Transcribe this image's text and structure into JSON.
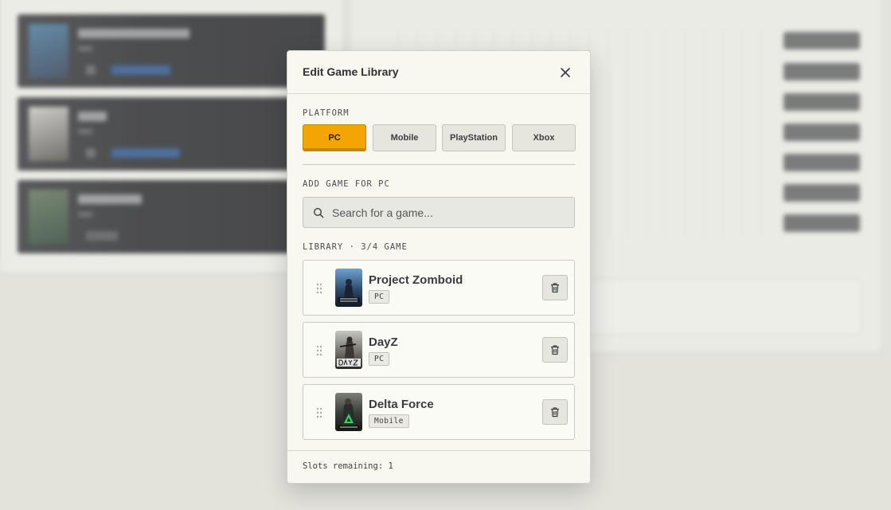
{
  "background": {
    "cards": [
      {
        "title": "Project Zomboid"
      },
      {
        "title": "DayZ"
      },
      {
        "title": "Delta Force"
      }
    ]
  },
  "modal": {
    "title": "Edit Game Library",
    "platform_label": "PLATFORM",
    "platforms": [
      {
        "label": "PC",
        "active": true
      },
      {
        "label": "Mobile",
        "active": false
      },
      {
        "label": "PlayStation",
        "active": false
      },
      {
        "label": "Xbox",
        "active": false
      }
    ],
    "add_game_label": "ADD GAME FOR PC",
    "search": {
      "placeholder": "Search for a game..."
    },
    "library_label": "LIBRARY · 3/4 GAME",
    "games": [
      {
        "name": "Project Zomboid",
        "platform": "PC",
        "cover_icon": "project-zomboid-cover"
      },
      {
        "name": "DayZ",
        "platform": "PC",
        "cover_icon": "dayz-cover"
      },
      {
        "name": "Delta Force",
        "platform": "Mobile",
        "cover_icon": "delta-force-cover"
      }
    ],
    "footer": "Slots remaining: 1"
  },
  "colors": {
    "accent": "#f4a405",
    "modal_bg": "#f8f8f1",
    "page_bg": "#e4e4dd"
  }
}
